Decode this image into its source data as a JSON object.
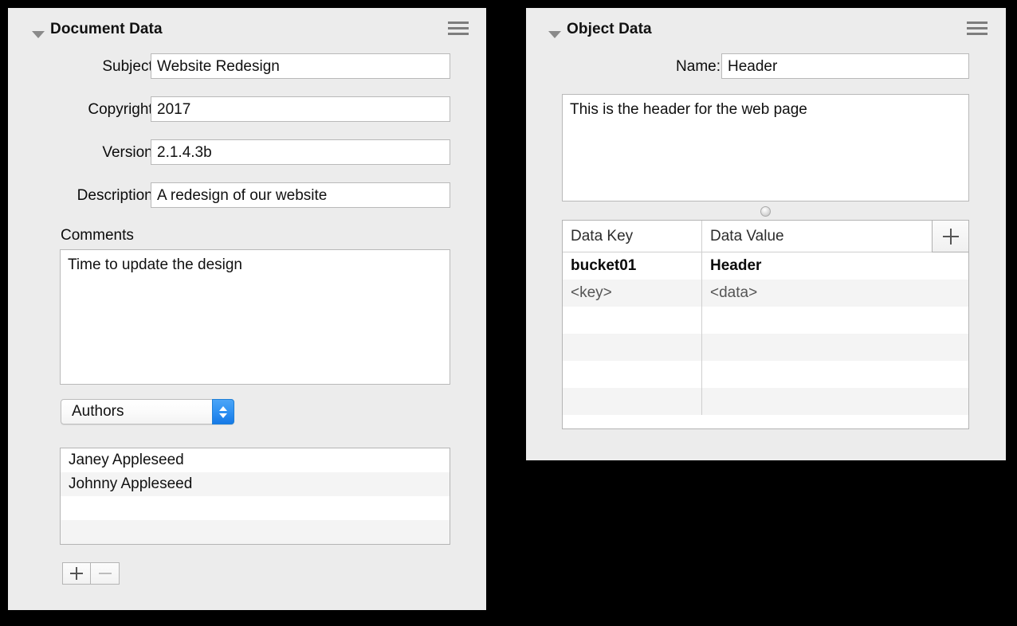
{
  "document_panel": {
    "title": "Document Data",
    "disclosure_state": "expanded",
    "menu_icon": "hamburger-menu-icon",
    "fields": [
      {
        "label": "Subject:",
        "value": "Website Redesign"
      },
      {
        "label": "Copyright:",
        "value": "2017"
      },
      {
        "label": "Version:",
        "value": "2.1.4.3b"
      },
      {
        "label": "Description:",
        "value": "A redesign of our website"
      }
    ],
    "comments": {
      "label": "Comments",
      "value": "Time to update the design"
    },
    "category_popup": {
      "selected": "Authors",
      "options": [
        "Authors"
      ]
    },
    "authors_list": [
      "Janey Appleseed",
      "Johnny Appleseed",
      "",
      ""
    ],
    "add_button_label": "+",
    "remove_button_label": "−",
    "remove_button_enabled": false
  },
  "object_panel": {
    "title": "Object Data",
    "disclosure_state": "expanded",
    "menu_icon": "hamburger-menu-icon",
    "name_field": {
      "label": "Name:",
      "value": "Header"
    },
    "notes": {
      "value": "This is the header for the web page"
    },
    "table": {
      "columns": [
        "Data Key",
        "Data Value"
      ],
      "add_button_label": "+",
      "rows": [
        {
          "key": "bucket01",
          "value": "Header",
          "style": "bold"
        },
        {
          "key": "<key>",
          "value": "<data>",
          "style": "placeholder"
        },
        {
          "key": "",
          "value": "",
          "style": "empty"
        },
        {
          "key": "",
          "value": "",
          "style": "empty"
        },
        {
          "key": "",
          "value": "",
          "style": "empty"
        },
        {
          "key": "",
          "value": "",
          "style": "empty"
        }
      ]
    }
  },
  "colors": {
    "panel_background": "#ececec",
    "window_background": "#000000",
    "accent_blue": "#2f91f2",
    "field_border": "#b9b9b9",
    "row_stripe": "#f4f4f4"
  }
}
